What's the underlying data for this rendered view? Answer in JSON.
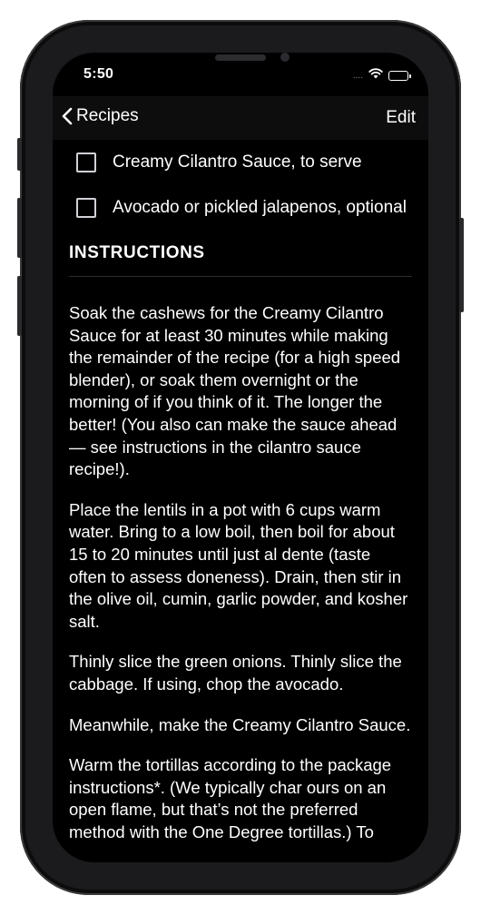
{
  "status_bar": {
    "time": "5:50",
    "cellular": "....",
    "icons": [
      "wifi-icon",
      "battery-icon"
    ]
  },
  "nav": {
    "back_label": "Recipes",
    "edit_label": "Edit"
  },
  "ingredients": [
    "Creamy Cilantro Sauce, to serve",
    "Avocado or pickled jalapenos, optional"
  ],
  "instructions": {
    "title": "INSTRUCTIONS",
    "steps": [
      "Soak the cashews for the Creamy Cilantro Sauce for at least 30 minutes while making the remainder of the recipe (for a high speed blender), or soak them overnight or the morning of if you think of it. The longer the better! (You also can make the sauce ahead — see instructions in the cilantro sauce recipe!).",
      "Place the lentils in a pot with 6 cups warm water. Bring to a low boil, then boil for about 15 to 20 minutes until just al dente (taste often to assess doneness). Drain, then stir in the olive oil, cumin, garlic powder, and kosher salt.",
      "Thinly slice the green onions. Thinly slice the cabbage. If using, chop the avocado.",
      "Meanwhile, make the Creamy Cilantro Sauce.",
      "Warm the tortillas according to the package instructions*. (We typically char ours on an open flame, but that’s not the preferred method with the One Degree tortillas.) To"
    ]
  },
  "colors": {
    "background": "#000000",
    "text": "#ffffff",
    "navbar": "#0d0d0d"
  }
}
